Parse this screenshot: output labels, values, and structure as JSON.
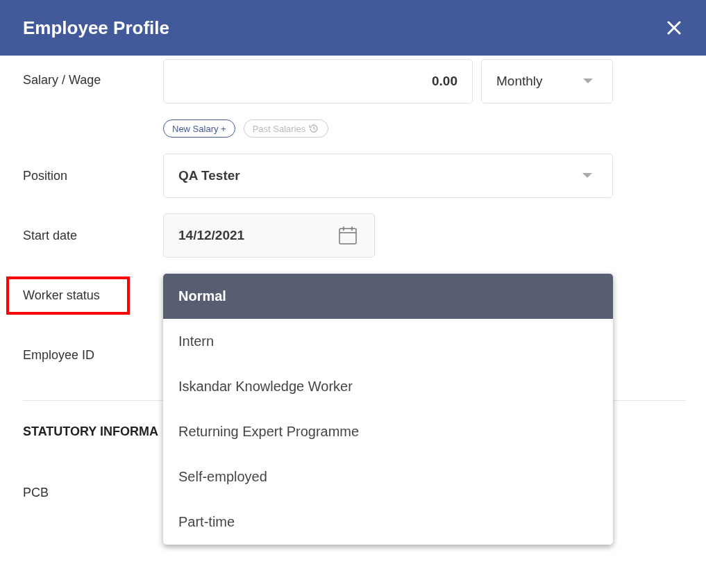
{
  "window": {
    "title": "Employee Profile"
  },
  "salary": {
    "label": "Salary / Wage",
    "value": "0.00",
    "period": "Monthly",
    "buttons": [
      {
        "label": "New Salary +",
        "disabled": false
      },
      {
        "label": "Past Salaries",
        "disabled": true
      }
    ]
  },
  "position": {
    "label": "Position",
    "value": "QA Tester"
  },
  "start_date": {
    "label": "Start date",
    "value": "14/12/2021"
  },
  "worker_status": {
    "label": "Worker status",
    "highlighted": true,
    "options": [
      {
        "label": "Normal",
        "selected": true
      },
      {
        "label": "Intern",
        "selected": false
      },
      {
        "label": "Iskandar Knowledge Worker",
        "selected": false
      },
      {
        "label": "Returning Expert Programme",
        "selected": false
      },
      {
        "label": "Self-employed",
        "selected": false
      },
      {
        "label": "Part-time",
        "selected": false
      }
    ]
  },
  "employee_id": {
    "label": "Employee ID"
  },
  "statutory": {
    "heading": "STATUTORY INFORMA",
    "fields": [
      {
        "label": "PCB"
      }
    ]
  }
}
